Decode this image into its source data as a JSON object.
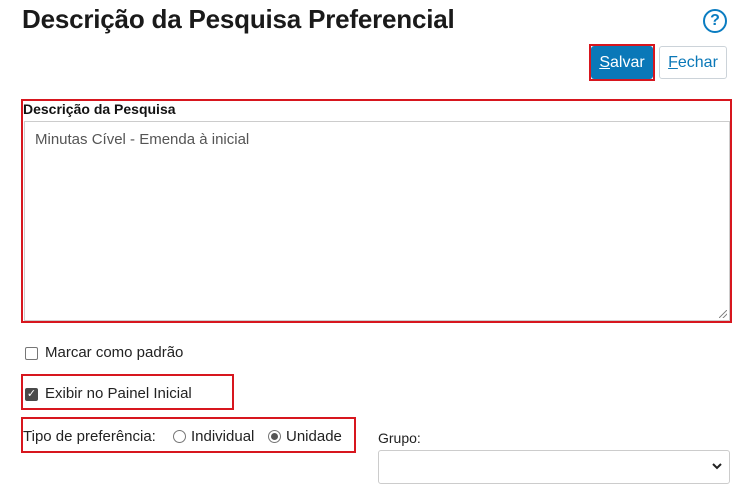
{
  "page": {
    "title": "Descrição da Pesquisa Preferencial",
    "help_icon": "question-circle-icon",
    "help_glyph": "?"
  },
  "toolbar": {
    "save_label": "Salvar",
    "save_key": "S",
    "save_rest": "alvar",
    "close_label": "Fechar",
    "close_key": "F",
    "close_rest": "echar"
  },
  "form": {
    "description_label": "Descrição da Pesquisa",
    "description_value": "Minutas Cível - Emenda à inicial",
    "default_label": "Marcar como padrão",
    "default_checked": false,
    "panel_label": "Exibir no Painel Inicial",
    "panel_checked": true,
    "pref_type_label": "Tipo de preferência:",
    "pref_options": [
      {
        "label": "Individual",
        "selected": false
      },
      {
        "label": "Unidade",
        "selected": true
      }
    ],
    "group_label": "Grupo:",
    "group_value": ""
  },
  "colors": {
    "primary": "#0a78b8",
    "highlight": "#d7161e"
  }
}
